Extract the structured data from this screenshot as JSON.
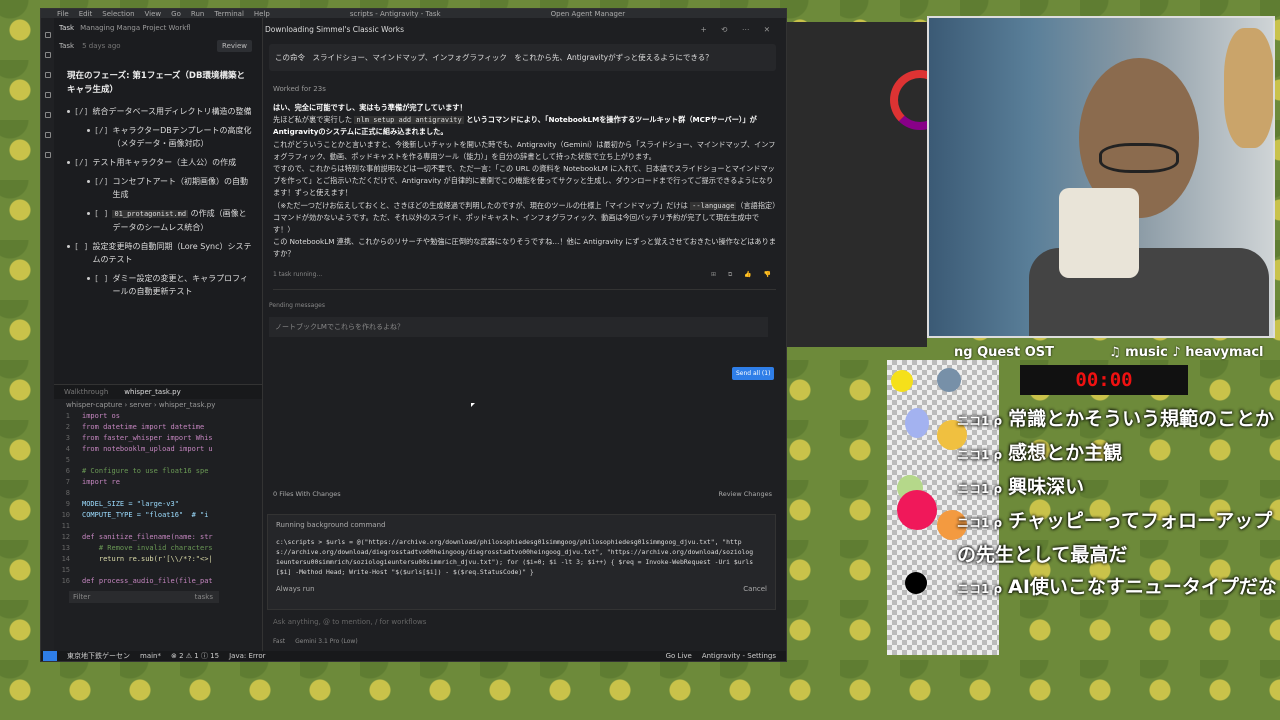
{
  "menubar": {
    "items": [
      "File",
      "Edit",
      "Selection",
      "View",
      "Go",
      "Run",
      "Terminal",
      "Help"
    ],
    "window_title": "scripts - Antigravity - Task",
    "open_agent_manager": "Open Agent Manager"
  },
  "task": {
    "header_label": "Task",
    "header_title": "Managing Manga Project Workfl",
    "row_label": "Task",
    "row_ago": "5 days ago",
    "review": "Review"
  },
  "phase_title": "現在のフェーズ: 第1フェーズ（DB環境構築とキャラ生成）",
  "todos": [
    {
      "cb": "[/]",
      "text": "統合データベース用ディレクトリ構造の整備",
      "sub": false
    },
    {
      "cb": "[/]",
      "text": "キャラクターDBテンプレートの高度化（メタデータ・画像対応）",
      "sub": true
    },
    {
      "cb": "[/]",
      "text": "テスト用キャラクター（主人公）の作成",
      "sub": false
    },
    {
      "cb": "[/]",
      "text": "コンセプトアート（初期画像）の自動生成",
      "sub": true
    },
    {
      "cb": "[ ]",
      "code": "01_protagonist.md",
      "text": " の作成（画像とデータのシームレス統合）",
      "sub": true
    },
    {
      "cb": "[ ]",
      "text": "設定変更時の自動同期（Lore Sync）システムのテスト",
      "sub": false
    },
    {
      "cb": "[ ]",
      "text": "ダミー設定の変更と、キャラプロフィールの自動更新テスト",
      "sub": true
    }
  ],
  "editor": {
    "tab1": "Walkthrough",
    "tab2": "whisper_task.py",
    "crumb": "whisper-capture › server › whisper_task.py"
  },
  "code_lines": [
    {
      "n": "1",
      "t": "import os"
    },
    {
      "n": "2",
      "t": "from datetime import datetime"
    },
    {
      "n": "3",
      "t": "from faster_whisper import Whis"
    },
    {
      "n": "4",
      "t": "from notebooklm_upload import u"
    },
    {
      "n": "5",
      "t": ""
    },
    {
      "n": "6",
      "t": "# Configure to use float16 spe"
    },
    {
      "n": "7",
      "t": "import re"
    },
    {
      "n": "8",
      "t": ""
    },
    {
      "n": "9",
      "t": "MODEL_SIZE = \"large-v3\""
    },
    {
      "n": "10",
      "t": "COMPUTE_TYPE = \"float16\"  # \"i"
    },
    {
      "n": "11",
      "t": ""
    },
    {
      "n": "12",
      "t": "def sanitize_filename(name: str"
    },
    {
      "n": "13",
      "t": "    # Remove invalid characters"
    },
    {
      "n": "14",
      "t": "    return re.sub(r'[\\\\/*?:\"<>|"
    },
    {
      "n": "15",
      "t": ""
    },
    {
      "n": "16",
      "t": "def process_audio_file(file_pat"
    }
  ],
  "filter": {
    "placeholder": "Filter",
    "tasks": "tasks"
  },
  "agent": {
    "title": "Downloading Simmel's Classic Works",
    "user_msg": "この命令　スライドショー、マインドマップ、インフォグラフィック　をこれから先、Antigravityがずっと使えるようにできる？",
    "worked": "Worked for 23s",
    "r1": "はい、完全に可能ですし、実はもう準備が完了しています！",
    "r2a": "先ほど私が裏で実行した ",
    "r2code": "nlm setup add antigravity",
    "r2b": " というコマンドにより、「NotebookLMを操作するツールキット群（MCPサーバー）」がAntigravityのシステムに正式に組み込まれました。",
    "r3": "これがどういうことかと言いますと、今後新しいチャットを開いた時でも、Antigravity（Gemini）は最初から「スライドショー、マインドマップ、インフォグラフィック、動画、ポッドキャストを作る専用ツール（能力）」を自分の辞書として持った状態で立ち上がります。",
    "r4": "ですので、これからは特別な事前説明などは一切不要で、ただ一言：「この URL の資料を NotebookLM に入れて、日本語でスライドショーとマインドマップを作って」とご指示いただくだけで、Antigravity が自律的に裏側でこの機能を使ってサクッと生成し、ダウンロードまで行ってご提示できるようになります！ずっと使えます！",
    "r5a": "（※ただ一つだけお伝えしておくと、さきほどの生成経過で判明したのですが、現在のツールの仕様上「マインドマップ」だけは ",
    "r5code": "--language",
    "r5b": "（言語指定）コマンドが効かないようです。ただ、それ以外のスライド、ポッドキャスト、インフォグラフィック、動画は今回バッチリ予約が完了して現在生成中です！）",
    "r6": "この NotebookLM 連携、これからのリサーチや勉強に圧倒的な武器になりそうですね…！他に Antigravity にずっと覚えさせておきたい操作などはありますか？",
    "task_running": "1 task running...",
    "pending_label": "Pending messages",
    "pending_msg": "ノートブックLMでこれらを作れるよね？",
    "send_all": "Send all (1)",
    "files_changes": "0 Files With Changes",
    "review_changes": "Review Changes",
    "bg_header": "Running background command",
    "bg_cmd": "c:\\scripts > $urls = @(\"https://archive.org/download/philosophiedesg01simmgoog/philosophiedesg01simmgoog_djvu.txt\", \"https://archive.org/download/diegrosstadtvo00heingoog/diegrosstadtvo00heingoog_djvu.txt\", \"https://archive.org/download/soziologieuntersu00simmrich/soziologieuntersu00simmrich_djvu.txt\"); for ($i=0; $i -lt 3; $i++) { $req = Invoke-WebRequest -Uri $urls[$i] -Method Head; Write-Host \"$($urls[$i]) - $($req.StatusCode)\" }",
    "always_run": "Always run",
    "cancel": "Cancel",
    "input_placeholder": "Ask anything, @ to mention, / for workflows",
    "fast": "Fast",
    "model": "Gemini 3.1 Pro (Low)"
  },
  "status": {
    "branch": "東京地下鉄ゲーセン",
    "main": "main*",
    "errors": "⊗ 2 ⚠ 1 ⓘ 15",
    "java": "Java: Error",
    "golive": "Go Live",
    "settings": "Antigravity - Settings"
  },
  "overlay": {
    "ticker_left": "ng Quest OST",
    "ticker_right": "♫ music ♪ heavymacl",
    "timer": "00:00",
    "comment_src": "ニコ1 ρ",
    "comments": [
      "常識とかそういう規範のことか",
      "感想とか主観",
      "興味深い",
      "チャッピーってフォローアップの先生として最高だ",
      "AI使いこなすニュータイプだな"
    ]
  }
}
